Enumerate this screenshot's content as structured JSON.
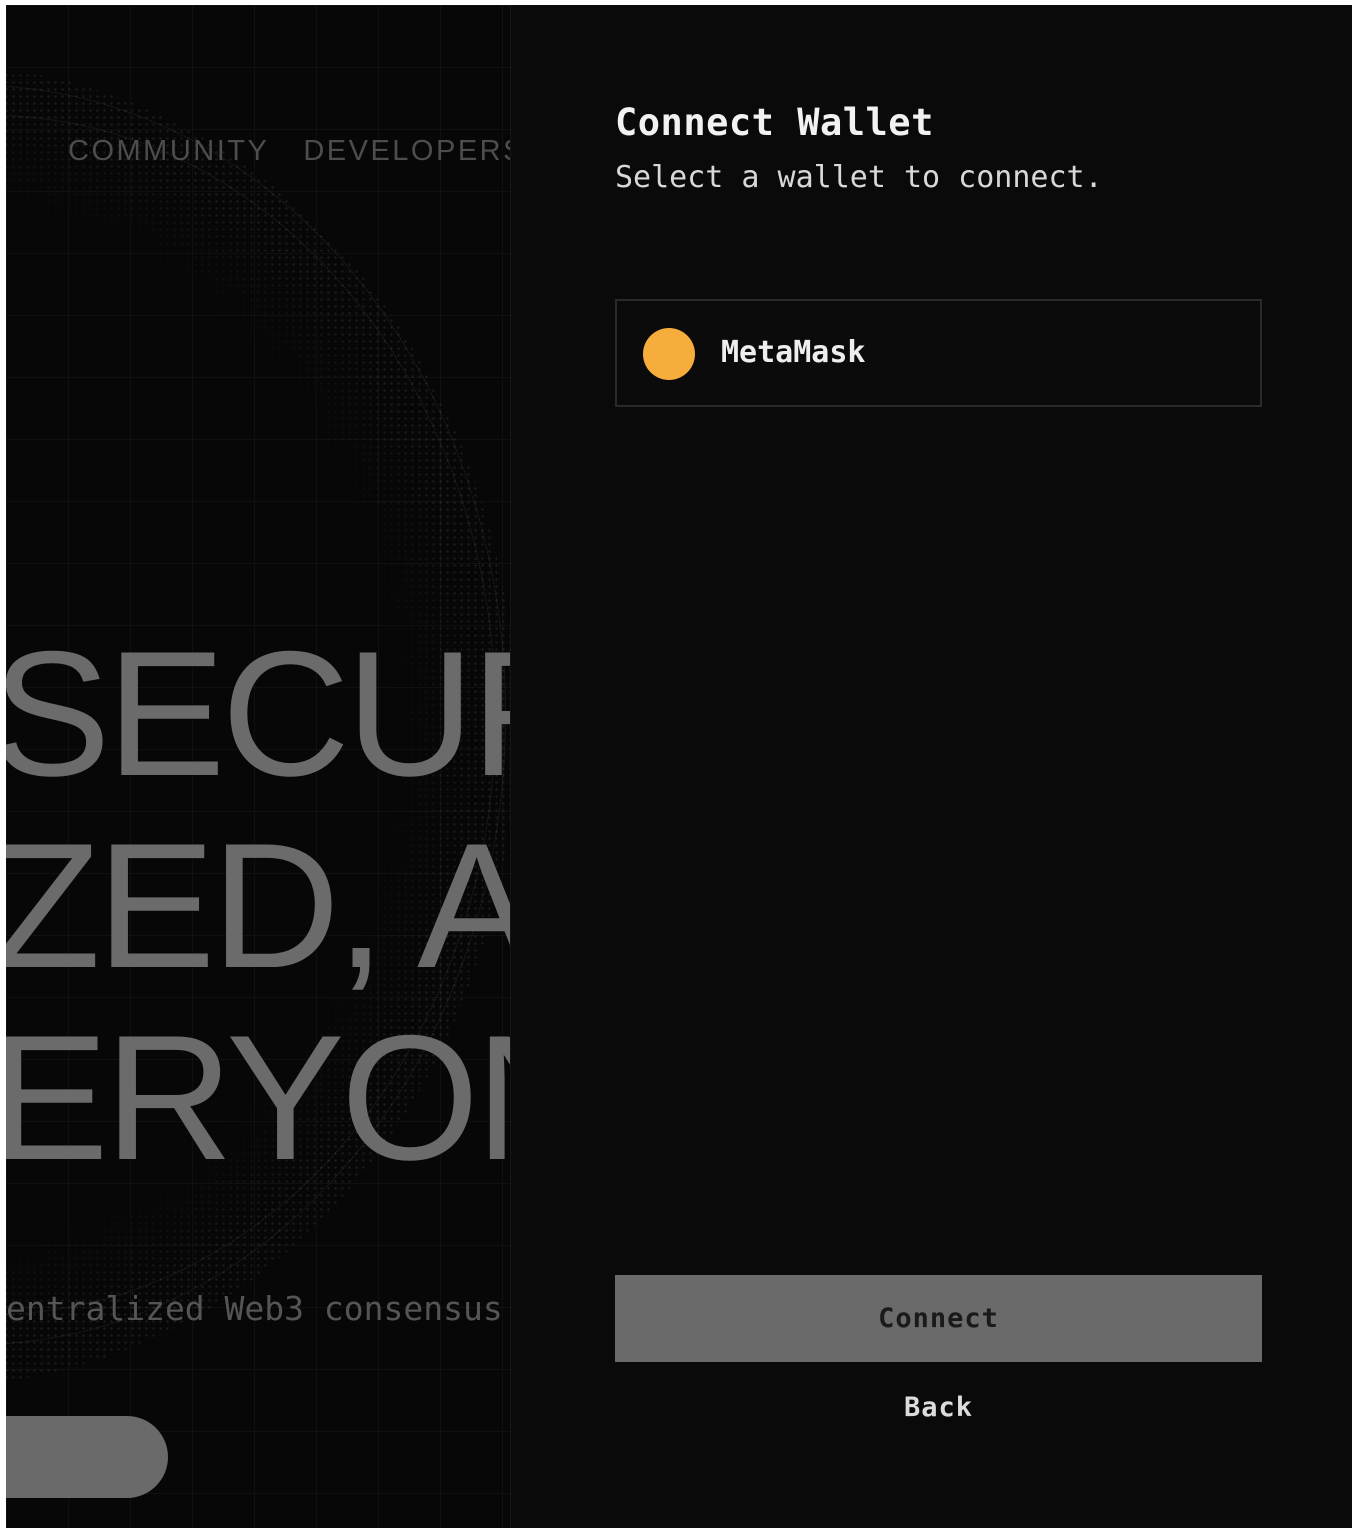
{
  "background_page": {
    "nav": [
      {
        "label": "COMMUNITY"
      },
      {
        "label": "DEVELOPERS"
      }
    ],
    "hero_lines": [
      "SECURE",
      "ZED, A",
      "ERYONE"
    ],
    "subheadline": "entralized Web3 consensus"
  },
  "modal": {
    "title": "Connect Wallet",
    "subtitle": "Select a wallet to connect.",
    "wallets": [
      {
        "label": "MetaMask",
        "icon": "metamask-icon",
        "icon_color": "#f6ad3c"
      }
    ],
    "connect_label": "Connect",
    "back_label": "Back"
  },
  "colors": {
    "background": "#050505",
    "panel": "#0a0a0a",
    "accent": "#f6ad3c",
    "button": "#6a6a6a"
  }
}
